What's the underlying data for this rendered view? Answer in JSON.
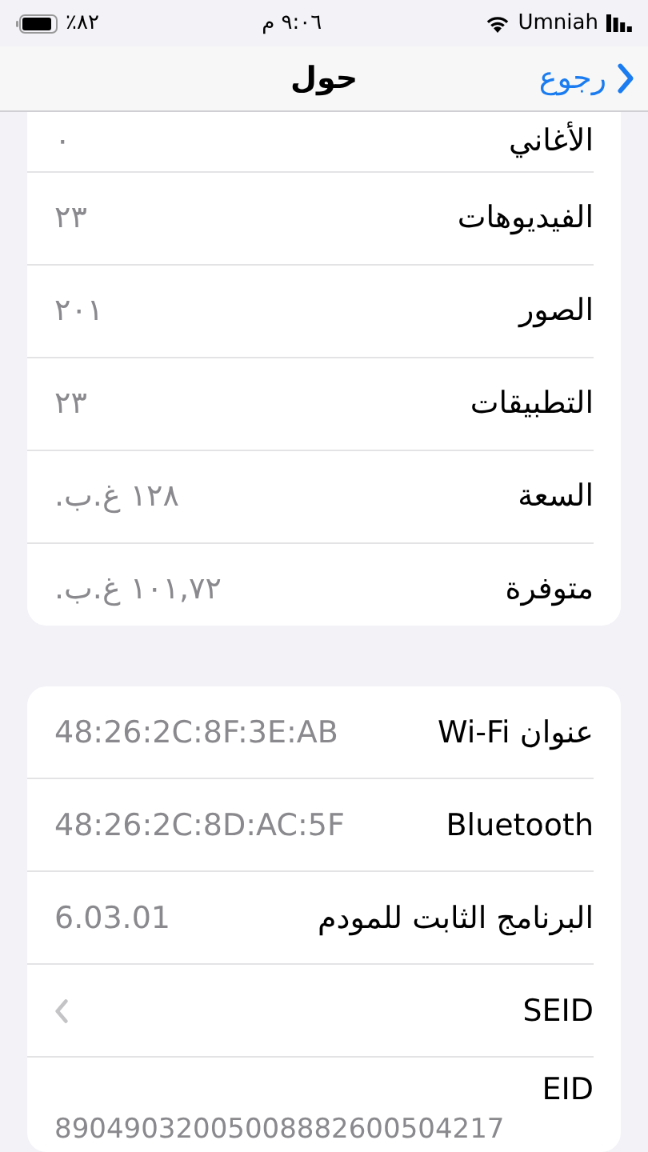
{
  "status_bar": {
    "battery": "٪٨٢",
    "time": "٩:٠٦ م",
    "carrier": "Umniah"
  },
  "nav": {
    "back": "رجوع",
    "title": "حول"
  },
  "sections": [
    {
      "rows": [
        {
          "kind": "value",
          "label": "الأغاني",
          "value": "٠"
        },
        {
          "kind": "value",
          "label": "الفيديوهات",
          "value": "٢٣"
        },
        {
          "kind": "value",
          "label": "الصور",
          "value": "٢٠١"
        },
        {
          "kind": "value",
          "label": "التطبيقات",
          "value": "٢٣"
        },
        {
          "kind": "value",
          "label": "السعة",
          "value": "١٢٨ غ.ب."
        },
        {
          "kind": "value",
          "label": "متوفرة",
          "value": "١٠١,٧٢ غ.ب."
        }
      ]
    },
    {
      "rows": [
        {
          "kind": "value",
          "label": "عنوان Wi-Fi",
          "value": "48:26:2C:8F:3E:AB"
        },
        {
          "kind": "value",
          "label": "Bluetooth",
          "value": "48:26:2C:8D:AC:5F"
        },
        {
          "kind": "value",
          "label": "البرنامج الثابت للمودم",
          "value": "6.03.01"
        },
        {
          "kind": "link",
          "label": "SEID"
        },
        {
          "kind": "stacked",
          "label": "EID",
          "value": "89049032005008882600504217"
        }
      ]
    }
  ]
}
